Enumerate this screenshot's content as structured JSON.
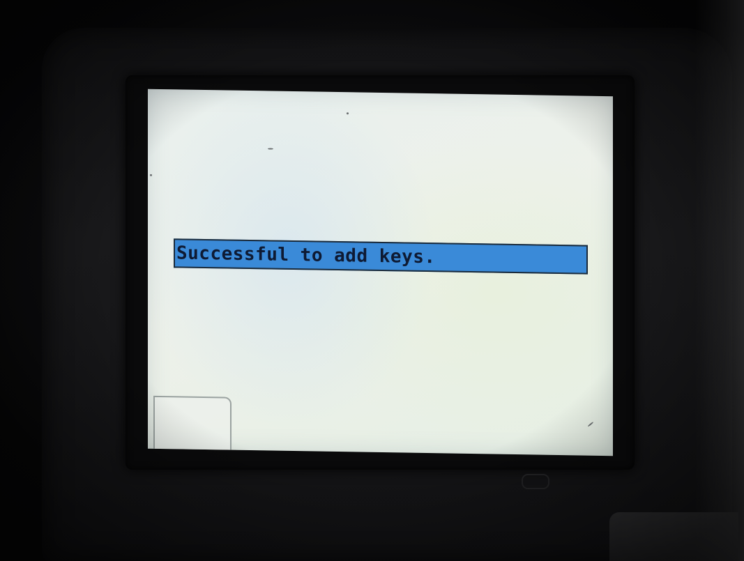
{
  "screen": {
    "message": "Successful to add keys.",
    "message_bar_color": "#3a8ad8",
    "background_color": "#ebf1ec"
  },
  "device": {
    "housing_color": "#151517"
  },
  "icons": [
    "status-message-bar",
    "corner-panel"
  ]
}
